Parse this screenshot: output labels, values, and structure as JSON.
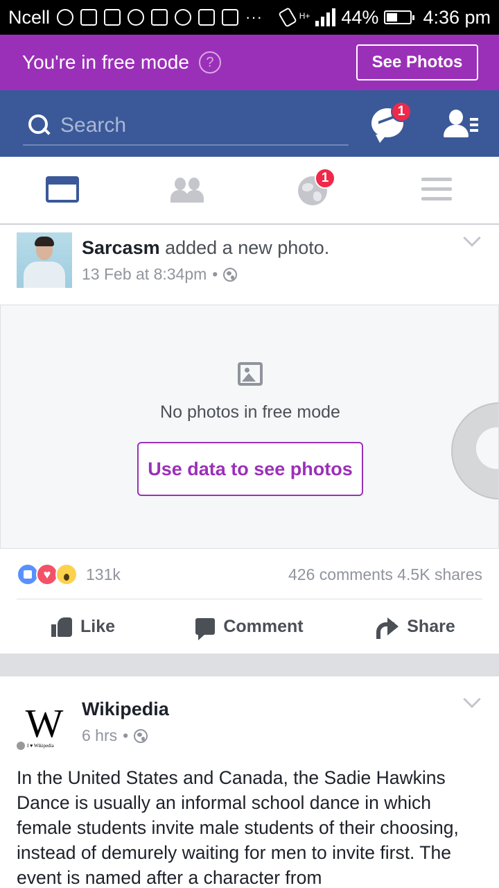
{
  "status_bar": {
    "carrier": "Ncell",
    "network": "H+",
    "battery": "44%",
    "time": "4:36 pm",
    "more": "···"
  },
  "free_mode": {
    "text": "You're in free mode",
    "help": "?",
    "see_photos": "See Photos",
    "accent": "#9b30b8"
  },
  "header": {
    "search_placeholder": "Search",
    "messenger_badge": "1",
    "brand": "#3b5998"
  },
  "nav": {
    "notifications_badge": "1"
  },
  "post1": {
    "author": "Sarcasm",
    "action": " added a new photo.",
    "time": "13 Feb at 8:34pm",
    "separator": "•",
    "no_photos": "No photos in free mode",
    "use_data": "Use data to see photos",
    "reactions_count": "131k",
    "stats": "426 comments  4.5K shares"
  },
  "actions": {
    "like": "Like",
    "comment": "Comment",
    "share": "Share"
  },
  "post2": {
    "author": "Wikipedia",
    "time": "6 hrs",
    "separator": "•",
    "logo_letter": "W",
    "logo_tag": "I ♥ Wikipedia",
    "body": "In the United States and Canada, the Sadie Hawkins Dance is usually an informal school dance in which female students invite male students of their choosing, instead of demurely waiting for men to invite first. The event is named after a character from"
  }
}
